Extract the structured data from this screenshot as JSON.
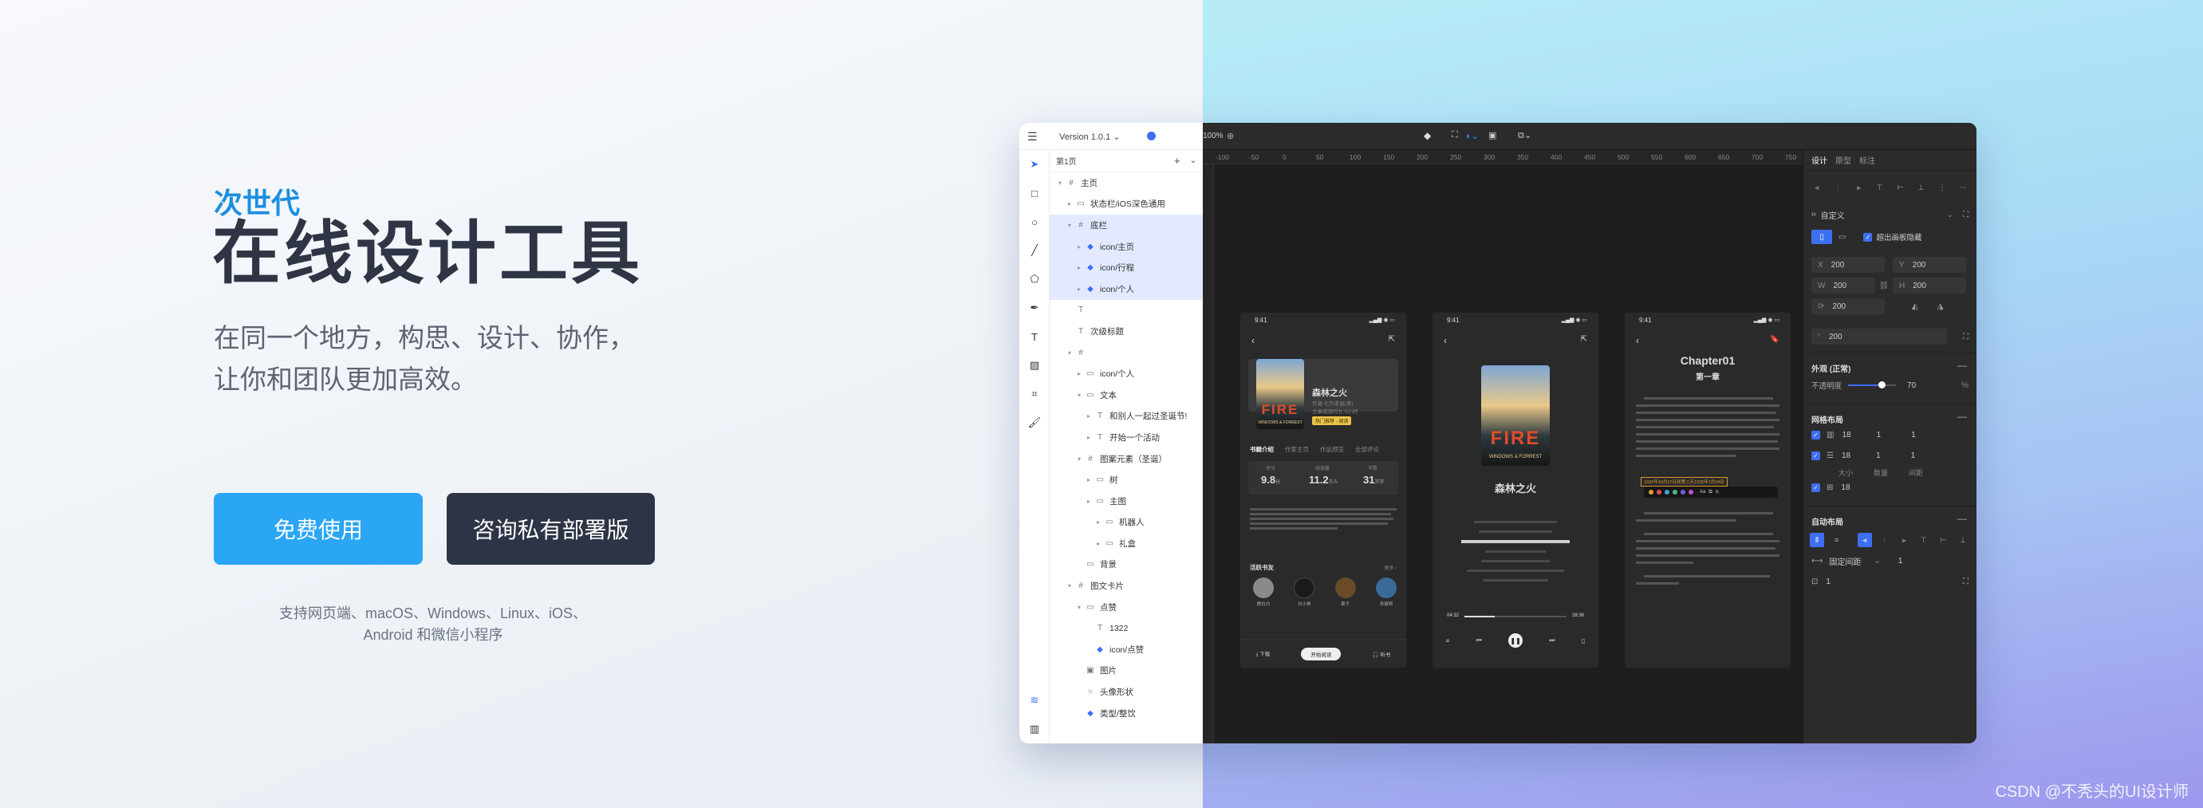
{
  "hero": {
    "subtitle": "次世代",
    "title": "在线设计工具",
    "desc_line1": "在同一个地方，构思、设计、协作，",
    "desc_line2": "让你和团队更加高效。",
    "btn_free": "免费使用",
    "btn_consult": "咨询私有部署版",
    "platforms_line1": "支持网页端、macOS、Windows、Linux、iOS、",
    "platforms_line2": "Android 和微信小程序"
  },
  "watermark": "CSDN @不秃头的UI设计师",
  "colors": {
    "accent": "#2aa6f4",
    "dark_button": "#2c3445",
    "select_blue": "#3d6ff2"
  },
  "app": {
    "toolbar": {
      "menu_icon": "menu-icon",
      "version": "Version 1.0.1",
      "zoom": "100%",
      "props_tabs": [
        "设计",
        "原型",
        "标注"
      ]
    },
    "page_selector": "第1页",
    "layers": [
      {
        "label": "主页",
        "indent": 0,
        "icon": "#",
        "caret": "▾",
        "selected": false
      },
      {
        "label": "状态栏/iOS深色通用",
        "indent": 1,
        "icon": "▭",
        "caret": "▸",
        "selected": false
      },
      {
        "label": "底栏",
        "indent": 1,
        "icon": "#",
        "caret": "▾",
        "selected": true
      },
      {
        "label": "icon/主页",
        "indent": 2,
        "icon": "◆",
        "caret": "▸",
        "selected": true
      },
      {
        "label": "icon/行程",
        "indent": 2,
        "icon": "◆",
        "caret": "▸",
        "selected": true
      },
      {
        "label": "icon/个人",
        "indent": 2,
        "icon": "◆",
        "caret": "▸",
        "selected": true
      },
      {
        "label": "",
        "indent": 1,
        "icon": "T",
        "caret": "",
        "selected": false
      },
      {
        "label": "次级标题",
        "indent": 1,
        "icon": "T",
        "caret": "",
        "selected": false
      },
      {
        "label": "",
        "indent": 1,
        "icon": "#",
        "caret": "▾",
        "selected": false
      },
      {
        "label": "icon/个人",
        "indent": 2,
        "icon": "▭",
        "caret": "▸",
        "selected": false
      },
      {
        "label": "文本",
        "indent": 2,
        "icon": "▭",
        "caret": "▾",
        "selected": false
      },
      {
        "label": "和别人一起过圣诞节!",
        "indent": 3,
        "icon": "T",
        "caret": "▸",
        "selected": false
      },
      {
        "label": "开始一个活动",
        "indent": 3,
        "icon": "T",
        "caret": "▸",
        "selected": false
      },
      {
        "label": "图案元素（圣诞）",
        "indent": 2,
        "icon": "#",
        "caret": "▾",
        "selected": false
      },
      {
        "label": "树",
        "indent": 3,
        "icon": "▭",
        "caret": "▸",
        "selected": false
      },
      {
        "label": "主图",
        "indent": 3,
        "icon": "▭",
        "caret": "▸",
        "selected": false
      },
      {
        "label": "机器人",
        "indent": 4,
        "icon": "▭",
        "caret": "▸",
        "selected": false
      },
      {
        "label": "礼盒",
        "indent": 4,
        "icon": "▭",
        "caret": "▸",
        "selected": false
      },
      {
        "label": "背景",
        "indent": 2,
        "icon": "▭",
        "caret": "",
        "selected": false
      },
      {
        "label": "图文卡片",
        "indent": 1,
        "icon": "#",
        "caret": "▾",
        "selected": false
      },
      {
        "label": "点赞",
        "indent": 2,
        "icon": "▭",
        "caret": "▾",
        "selected": false
      },
      {
        "label": "1322",
        "indent": 3,
        "icon": "T",
        "caret": "",
        "selected": false
      },
      {
        "label": "icon/点赞",
        "indent": 3,
        "icon": "◆",
        "caret": "",
        "selected": false
      },
      {
        "label": "图片",
        "indent": 2,
        "icon": "▣",
        "caret": "",
        "selected": false
      },
      {
        "label": "头像形状",
        "indent": 2,
        "icon": "○",
        "caret": "",
        "selected": false
      },
      {
        "label": "类型/整饮",
        "indent": 2,
        "icon": "◆",
        "caret": "",
        "selected": false
      }
    ],
    "ruler_ticks": [
      "-100",
      "-50",
      "0",
      "50",
      "100",
      "150",
      "200",
      "250",
      "300",
      "350",
      "400",
      "450",
      "500",
      "550",
      "600",
      "650",
      "700",
      "750"
    ],
    "phone1": {
      "time": "9:41",
      "book_title": "森林之火",
      "meta1": "作者:七只老鼠(美)",
      "meta2": "文章阅读时长:5小时",
      "tag": "热门推荐 · 阅读",
      "tabs": [
        "书籍介绍",
        "作家主页",
        "作品预览",
        "全部评论"
      ],
      "stats": [
        {
          "label": "评分",
          "value": "9.8",
          "unit": "分"
        },
        {
          "label": "阅读量",
          "value": "11.2",
          "unit": "万人"
        },
        {
          "label": "字数",
          "value": "31",
          "unit": "万字"
        }
      ],
      "section": "活跃书友",
      "more": "更多 ›",
      "friends": [
        "鹿白白",
        "白小骨",
        "果子",
        "青春期"
      ],
      "actions": [
        "下载",
        "开始阅读",
        "听书"
      ]
    },
    "phone2": {
      "time": "9:41",
      "book_title": "森林之火",
      "time_start": "04:32",
      "time_end": "28:36"
    },
    "phone3": {
      "time": "9:41",
      "chapter": "Chapter01",
      "chapter_cn": "第一章",
      "highlight": "1932年10月27日到第二天1932年7月24日"
    },
    "props": {
      "frame_label": "自定义",
      "clip_label": "超出画板隐藏",
      "x_label": "X",
      "x": "200",
      "y_label": "Y",
      "y": "200",
      "w_label": "W",
      "w": "200",
      "h_label": "H",
      "h": "200",
      "rot": "200",
      "radius": "200",
      "appearance": "外观 (正常)",
      "opacity_label": "不透明度",
      "opacity": "70",
      "opacity_unit": "%",
      "grid_title": "网格布局",
      "grid_rows": [
        {
          "a": "18",
          "b": "1",
          "c": "1"
        },
        {
          "a": "18",
          "b": "1",
          "c": "1"
        }
      ],
      "grid_labels": [
        "大小",
        "数量",
        "间距"
      ],
      "grid_last": "18",
      "auto_title": "自动布局",
      "auto_gap_label": "固定间距",
      "auto_gap": "1",
      "auto_pad": "1"
    }
  }
}
